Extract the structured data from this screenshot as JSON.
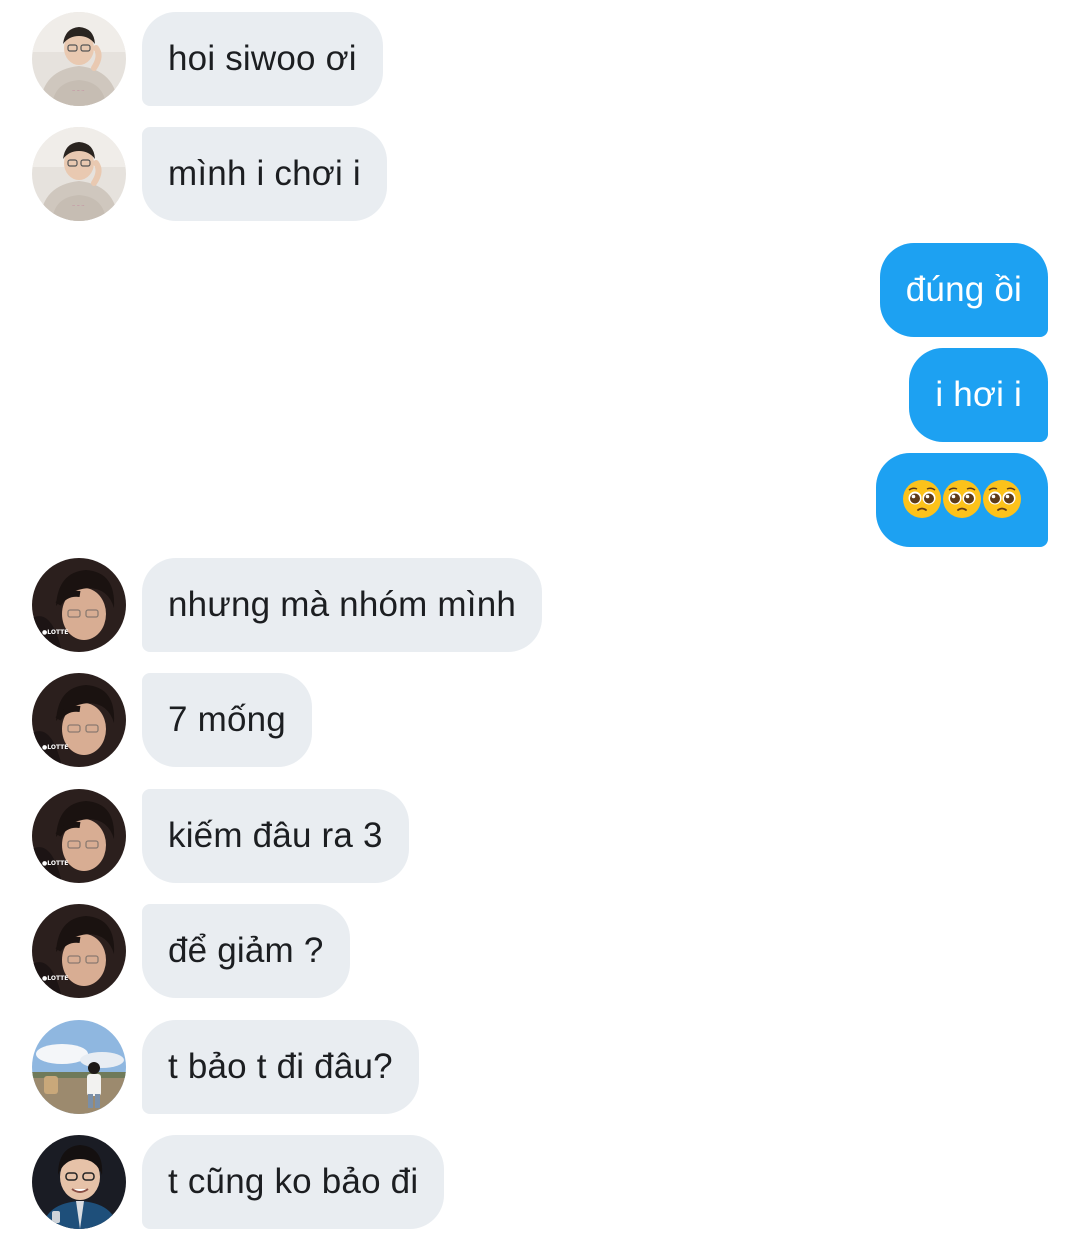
{
  "conversation": {
    "messages": [
      {
        "sender": "friend_a",
        "direction": "incoming",
        "text": "hoi siwoo ơi"
      },
      {
        "sender": "friend_a",
        "direction": "incoming",
        "text": "mình i chơi i"
      },
      {
        "sender": "me",
        "direction": "outgoing",
        "text": "đúng ồi"
      },
      {
        "sender": "me",
        "direction": "outgoing",
        "text": "i hơi i"
      },
      {
        "sender": "me",
        "direction": "outgoing",
        "text": "🥺🥺🥺"
      },
      {
        "sender": "friend_b",
        "direction": "incoming",
        "text": "nhưng mà nhóm mình"
      },
      {
        "sender": "friend_b",
        "direction": "incoming",
        "text": "7 mống"
      },
      {
        "sender": "friend_b",
        "direction": "incoming",
        "text": "kiếm đâu ra 3"
      },
      {
        "sender": "friend_b",
        "direction": "incoming",
        "text": "để giảm ?"
      },
      {
        "sender": "friend_c",
        "direction": "incoming",
        "text": "t bảo t đi đâu?"
      },
      {
        "sender": "friend_d",
        "direction": "incoming",
        "text": "t cũng ko bảo đi"
      }
    ]
  },
  "colors": {
    "incoming_bubble": "#e9edf1",
    "outgoing_bubble": "#1da1f2",
    "incoming_text": "#1c1e21",
    "outgoing_text": "#ffffff",
    "background": "#ffffff"
  },
  "icons": {
    "emoji": "pleading-face-emoji"
  }
}
